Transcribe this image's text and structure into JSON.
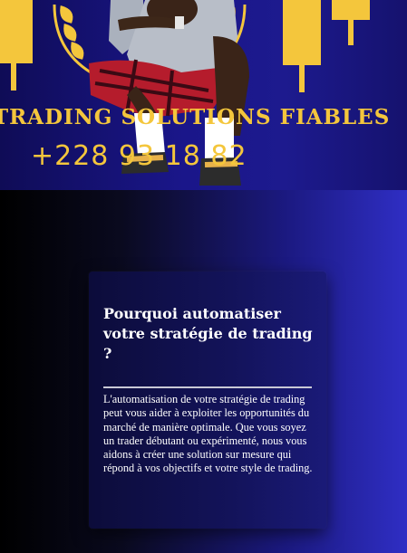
{
  "hero": {
    "brand_text": "TRADING SOLUTIONS FIABLES",
    "phone_text": "+228 93 18 82",
    "accent_color": "#f4c63c",
    "background_color": "#1a168a"
  },
  "section": {
    "title": "Pourquoi automatiser votre stratégie de trading ?",
    "body": "L'automatisation de votre stratégie de trading peut vous aider à exploiter les opportunités du marché de manière optimale. Que vous soyez un trader débutant ou expérimenté, nous vous aidons à créer une solution sur mesure qui répond à vos objectifs et votre style de trading."
  }
}
